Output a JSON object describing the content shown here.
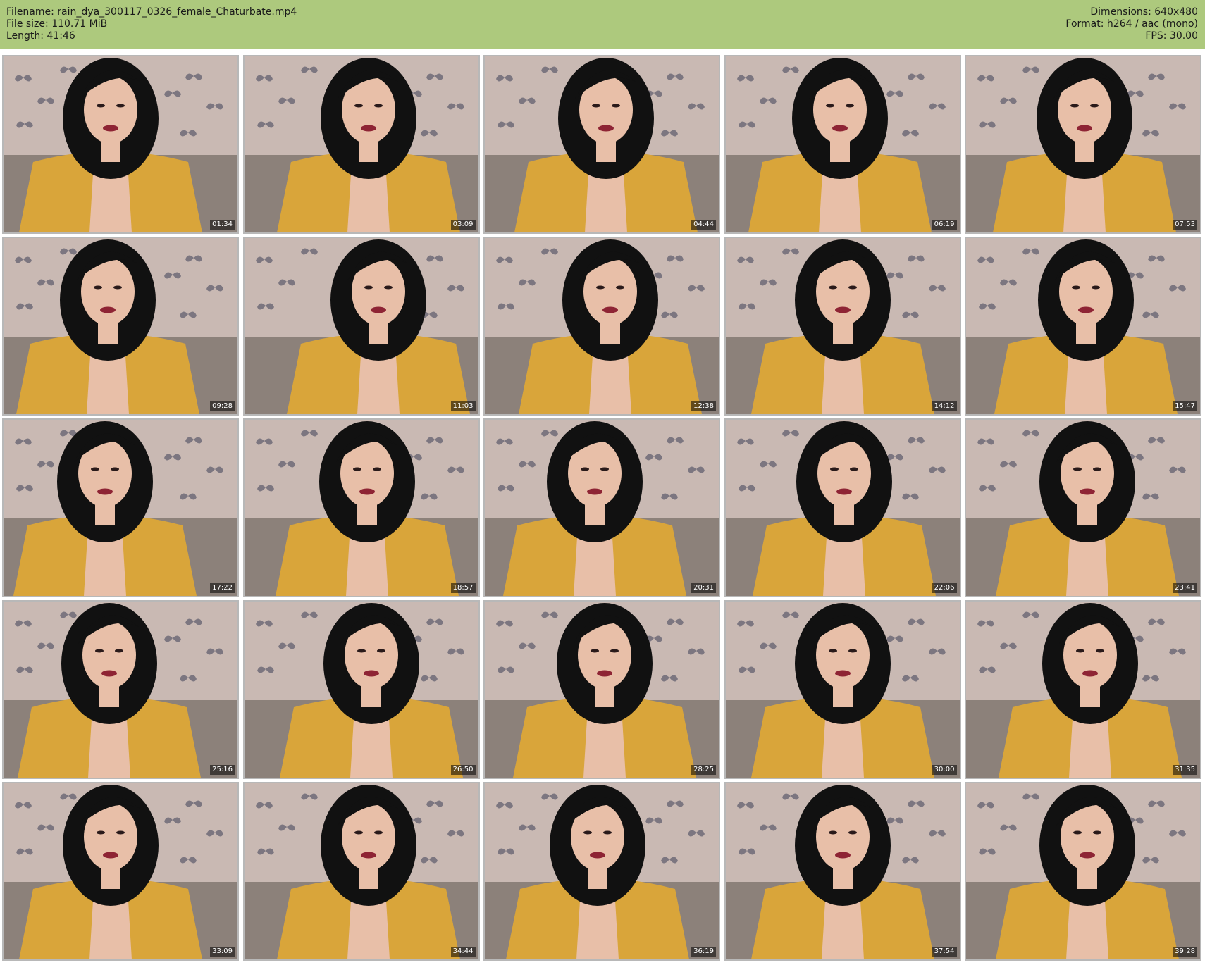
{
  "header": {
    "filename_line": "Filename: rain_dya_300117_0326_female_Chaturbate.mp4",
    "filesize_line": "File size: 110.71 MiB",
    "length_line": "Length: 41:46",
    "dimensions_line": "Dimensions: 640x480",
    "format_line": "Format: h264 / aac (mono)",
    "fps_line": "FPS: 30.00"
  },
  "colors": {
    "header_background": "#adc97d",
    "wallpaper": "#c9b9b3",
    "sofa": "#8c817a",
    "cardigan": "#d9a53a",
    "hair": "#111111",
    "skin": "#e8bfa8",
    "lips": "#8e2434"
  },
  "thumbnails": [
    {
      "timestamp": "01:34"
    },
    {
      "timestamp": "03:09"
    },
    {
      "timestamp": "04:44"
    },
    {
      "timestamp": "06:19"
    },
    {
      "timestamp": "07:53"
    },
    {
      "timestamp": "09:28"
    },
    {
      "timestamp": "11:03"
    },
    {
      "timestamp": "12:38"
    },
    {
      "timestamp": "14:12"
    },
    {
      "timestamp": "15:47"
    },
    {
      "timestamp": "17:22"
    },
    {
      "timestamp": "18:57"
    },
    {
      "timestamp": "20:31"
    },
    {
      "timestamp": "22:06"
    },
    {
      "timestamp": "23:41"
    },
    {
      "timestamp": "25:16"
    },
    {
      "timestamp": "26:50"
    },
    {
      "timestamp": "28:25"
    },
    {
      "timestamp": "30:00"
    },
    {
      "timestamp": "31:35"
    },
    {
      "timestamp": "33:09"
    },
    {
      "timestamp": "34:44"
    },
    {
      "timestamp": "36:19"
    },
    {
      "timestamp": "37:54"
    },
    {
      "timestamp": "39:28"
    }
  ]
}
